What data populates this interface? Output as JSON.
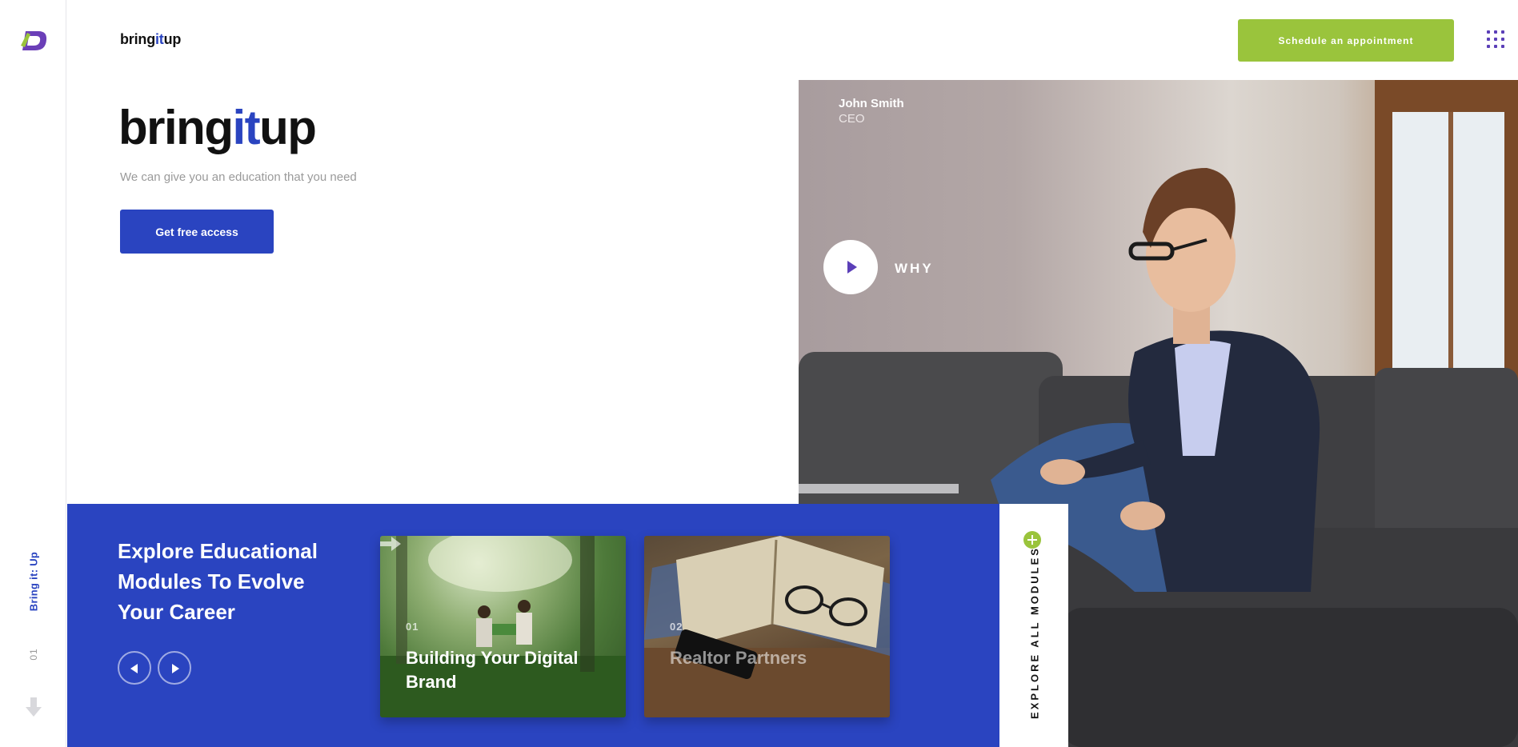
{
  "rail": {
    "label": "Bring it: Up",
    "slide_number": "01"
  },
  "header": {
    "brand_prefix": "bring",
    "brand_accent": "it",
    "brand_suffix": "up",
    "schedule_label": "Schedule an appointment"
  },
  "hero": {
    "title_prefix": "bring",
    "title_accent": "it",
    "title_suffix": "up",
    "subtitle": "We can give you an education that you need",
    "cta_label": "Get free access",
    "person_name": "John Smith",
    "person_role": "CEO",
    "why_label": "WHY"
  },
  "modules": {
    "title": "Explore Educational Modules To Evolve Your Career",
    "cards": [
      {
        "number": "01",
        "title": "Building Your Digital Brand"
      },
      {
        "number": "02",
        "title": "Realtor Partners"
      }
    ],
    "explore_all_label": "EXPLORE ALL MODULES"
  },
  "colors": {
    "brand_blue": "#2a44c0",
    "accent_green": "#9ac43c",
    "accent_purple": "#5b3fb8"
  },
  "icons": [
    "logo-icon",
    "menu-grid-icon",
    "play-icon",
    "arrow-left-icon",
    "arrow-right-icon",
    "card-arrow-icon",
    "plus-icon",
    "scroll-down-icon"
  ]
}
